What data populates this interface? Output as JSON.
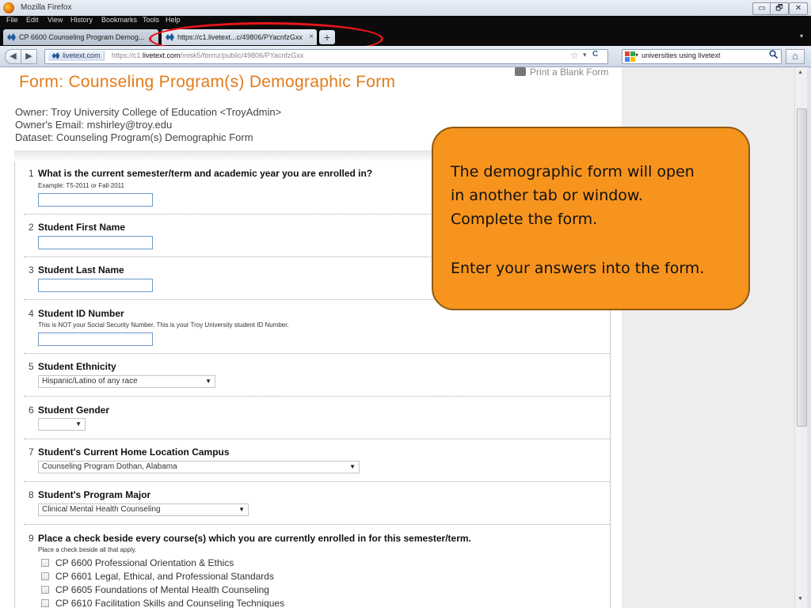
{
  "window": {
    "title": "Mozilla Firefox",
    "minimize": "▭",
    "maximize": "🗗",
    "close": "✕"
  },
  "menu": [
    "File",
    "Edit",
    "View",
    "History",
    "Bookmarks",
    "Tools",
    "Help"
  ],
  "tabs": [
    {
      "label": "CP 6600 Counseling Program Demog..."
    },
    {
      "label": "https://c1.livetext...c/49806/PYacnfzGxx",
      "close": "×"
    }
  ],
  "new_tab_label": "+",
  "nav": {
    "back": "◀",
    "forward": "▶",
    "site_identity": "livetext.com",
    "url_prefix": "https://c1.",
    "url_domain": "livetext.com",
    "url_path": "/misk5/formz/public/49806/PYacnfzGxx",
    "star": "☆",
    "dropdown": "▾",
    "reload": "C",
    "search_query": "universities using livetext",
    "search_icon": "magnifier-icon",
    "home": "⌂"
  },
  "page": {
    "title": "Form: Counseling Program(s) Demographic Form",
    "print_link": "Print a Blank Form",
    "owner": "Owner: Troy University College of Education <TroyAdmin>",
    "owner_email": "Owner's Email: mshirley@troy.edu",
    "dataset": "Dataset: Counseling Program(s) Demographic Form"
  },
  "questions": [
    {
      "num": "1",
      "label": "What is the current semester/term and academic year you are enrolled in?",
      "hint": "Example: T5-2011 or Fall-2011"
    },
    {
      "num": "2",
      "label": "Student First Name"
    },
    {
      "num": "3",
      "label": "Student Last Name"
    },
    {
      "num": "4",
      "label": "Student ID Number",
      "hint": "This is NOT your Social Security Number. This is your Troy University student ID Number."
    },
    {
      "num": "5",
      "label": "Student Ethnicity",
      "value": "Hispanic/Latino of any race"
    },
    {
      "num": "6",
      "label": "Student Gender",
      "value": ""
    },
    {
      "num": "7",
      "label": "Student's Current Home Location Campus",
      "value": "Counseling Program Dothan, Alabama"
    },
    {
      "num": "8",
      "label": "Student's Program Major",
      "value": "Clinical Mental Health Counseling"
    },
    {
      "num": "9",
      "label": "Place a check beside every course(s) which you are currently enrolled in for this semester/term.",
      "hint": "Place a check beside all that apply."
    }
  ],
  "courses": [
    "CP 6600 Professional Orientation & Ethics",
    "CP 6601 Legal, Ethical, and Professional Standards",
    "CP 6605 Foundations of Mental Health Counseling",
    "CP 6610 Facilitation Skills and Counseling Techniques"
  ],
  "callout": {
    "line1": "The demographic form will open",
    "line2": "in another tab or window.",
    "line3": "Complete the form.",
    "line4": "Enter your answers into the form.",
    "fill": "#f7941e"
  },
  "colors": {
    "title_orange": "#e37b1a",
    "annotation_red": "#e8151b"
  }
}
